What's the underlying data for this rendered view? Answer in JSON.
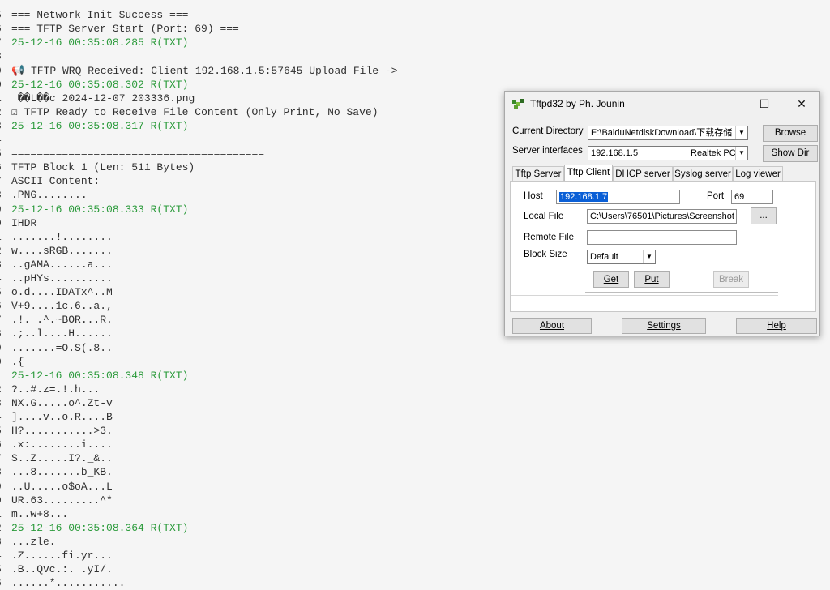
{
  "log": {
    "lines": [
      {
        "n": "4",
        "t": ""
      },
      {
        "n": "5",
        "t": "=== Network Init Success ==="
      },
      {
        "n": "6",
        "t": "=== TFTP Server Start (Port: 69) ==="
      },
      {
        "n": "7",
        "t": "25-12-16 00:35:08.285 R(TXT)",
        "ts": true
      },
      {
        "n": "8",
        "t": ""
      },
      {
        "n": "9",
        "t": "📢 TFTP WRQ Received: Client 192.168.1.5:57645 Upload File ->"
      },
      {
        "n": "0",
        "t": "25-12-16 00:35:08.302 R(TXT)",
        "ts": true
      },
      {
        "n": "1",
        "t": " ��L��c 2024-12-07 203336.png"
      },
      {
        "n": "2",
        "t": "☑ TFTP Ready to Receive File Content (Only Print, No Save)"
      },
      {
        "n": "3",
        "t": "25-12-16 00:35:08.317 R(TXT)",
        "ts": true
      },
      {
        "n": "4",
        "t": ""
      },
      {
        "n": "5",
        "t": "========================================"
      },
      {
        "n": "6",
        "t": "TFTP Block 1 (Len: 511 Bytes)"
      },
      {
        "n": "7",
        "t": "ASCII Content:"
      },
      {
        "n": "8",
        "t": ".PNG........"
      },
      {
        "n": "9",
        "t": "25-12-16 00:35:08.333 R(TXT)",
        "ts": true
      },
      {
        "n": "0",
        "t": "IHDR"
      },
      {
        "n": "1",
        "t": ".......!........"
      },
      {
        "n": "2",
        "t": "w....sRGB......."
      },
      {
        "n": "3",
        "t": "..gAMA......a..."
      },
      {
        "n": "4",
        "t": "..pHYs.........."
      },
      {
        "n": "5",
        "t": "o.d....IDATx^..M"
      },
      {
        "n": "6",
        "t": "V+9....1c.6..a.,"
      },
      {
        "n": "7",
        "t": ".!. .^.~BOR...R."
      },
      {
        "n": "8",
        "t": ".;..l....H......"
      },
      {
        "n": "9",
        "t": ".......=O.S(.8.."
      },
      {
        "n": "0",
        "t": ".{"
      },
      {
        "n": "1",
        "t": "25-12-16 00:35:08.348 R(TXT)",
        "ts": true
      },
      {
        "n": "2",
        "t": "?..#.z=.!.h..."
      },
      {
        "n": "3",
        "t": "NX.G.....o^.Zt-v"
      },
      {
        "n": "4",
        "t": "]....v..o.R....B"
      },
      {
        "n": "5",
        "t": "H?...........>3."
      },
      {
        "n": "6",
        "t": ".x:........i...."
      },
      {
        "n": "7",
        "t": "S..Z.....I?._&.."
      },
      {
        "n": "8",
        "t": "...8.......b_KB."
      },
      {
        "n": "9",
        "t": "..U.....o$oA...L"
      },
      {
        "n": "0",
        "t": "UR.63.........^*"
      },
      {
        "n": "1",
        "t": "m..w+8..."
      },
      {
        "n": "2",
        "t": "25-12-16 00:35:08.364 R(TXT)",
        "ts": true
      },
      {
        "n": "3",
        "t": "...zle."
      },
      {
        "n": "4",
        "t": ".Z......fi.yr..."
      },
      {
        "n": "5",
        "t": ".B..Qvc.:. .yI/."
      },
      {
        "n": "6",
        "t": "......*..........."
      }
    ]
  },
  "dialog": {
    "title": "Tftpd32 by Ph. Jounin",
    "window_buttons": {
      "minimize": "—",
      "maximize": "☐",
      "close": "✕"
    },
    "current_directory_label": "Current Directory",
    "current_directory_value": "E:\\BaiduNetdiskDownload\\下载存储",
    "browse_label": "Browse",
    "server_interfaces_label": "Server interfaces",
    "server_interface_ip": "192.168.1.5",
    "server_interface_name": "Realtek PC",
    "show_dir_label": "Show Dir",
    "tabs": [
      {
        "label": "Tftp Server"
      },
      {
        "label": "Tftp Client"
      },
      {
        "label": "DHCP server"
      },
      {
        "label": "Syslog server"
      },
      {
        "label": "Log viewer"
      }
    ],
    "host_label": "Host",
    "host_value": "192.168.1.7",
    "port_label": "Port",
    "port_value": "69",
    "local_file_label": "Local File",
    "local_file_value": "C:\\Users\\76501\\Pictures\\Screenshot",
    "browse_file_label": "...",
    "remote_file_label": "Remote File",
    "remote_file_value": "",
    "block_size_label": "Block Size",
    "block_size_value": "Default",
    "get_label": "Get",
    "put_label": "Put",
    "break_label": "Break",
    "about_label": "About",
    "settings_label": "Settings",
    "help_label": "Help"
  }
}
